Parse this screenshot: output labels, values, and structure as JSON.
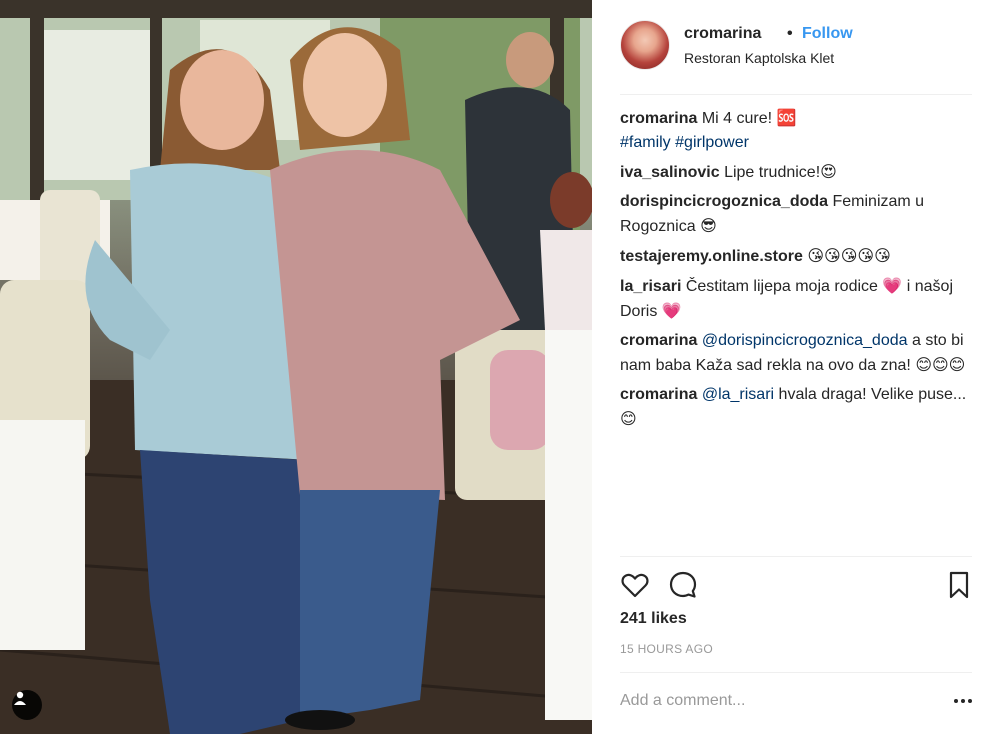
{
  "post": {
    "photo_alt": "",
    "user_tag_icon": "person-icon"
  },
  "header": {
    "username": "cromarina",
    "separator": "•",
    "follow_label": "Follow",
    "location": "Restoran Kaptolska Klet"
  },
  "caption": {
    "username": "cromarina",
    "text": "Mi 4 cure! ",
    "emoji": "🆘",
    "hashtags": [
      "#family",
      "#girlpower"
    ]
  },
  "comments": [
    {
      "username": "iva_salinovic",
      "text": "Lipe trudnice!",
      "emoji": "😍"
    },
    {
      "username": "dorispincicrogoznica_doda",
      "text": "Feminizam u Rogoznica",
      "emoji": "😎"
    },
    {
      "username": "testajeremy.online.store",
      "text": "",
      "emoji": "😘😘😘😘😘"
    },
    {
      "username": "la_risari",
      "text": "Čestitam lijepa moja rodice",
      "emoji": "💗",
      "text2": " i našoj Doris ",
      "emoji2": "💗"
    },
    {
      "username": "cromarina",
      "mention": "@dorispincicrogoznica_doda",
      "text": " a sto bi nam baba Kaža sad rekla na ovo da zna! ",
      "emoji": "😊😊😊"
    },
    {
      "username": "cromarina",
      "mention": "@la_risari",
      "text": " hvala draga! Velike puse... ",
      "emoji": "😊"
    }
  ],
  "actions": {
    "like_icon": "heart-icon",
    "comment_icon": "comment-bubble-icon",
    "save_icon": "bookmark-icon",
    "likes": "241 likes",
    "timestamp": "15 HOURS AGO"
  },
  "add_comment": {
    "placeholder": "Add a comment...",
    "more_icon": "more-options-icon"
  },
  "colors": {
    "follow": "#3897f0",
    "link": "#003569",
    "muted": "#999999",
    "divider": "#efefef"
  }
}
